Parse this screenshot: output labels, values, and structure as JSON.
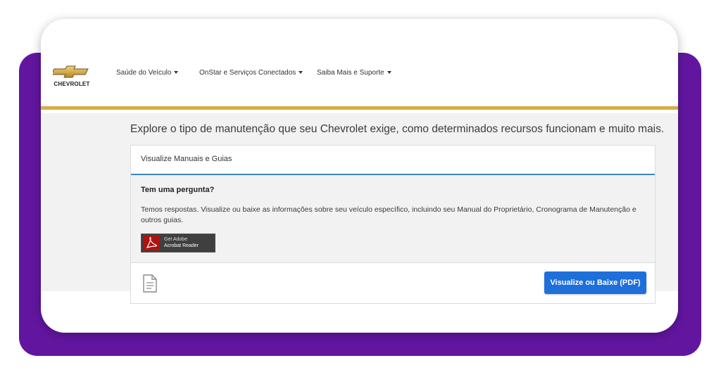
{
  "brand": {
    "logo_text": "CHEVROLET",
    "gold_color": "#d8ae43"
  },
  "nav": {
    "items": [
      {
        "label": "Saúde do Veículo"
      },
      {
        "label": "OnStar e Serviços Conectados"
      },
      {
        "label": "Saiba Mais e Suporte"
      }
    ]
  },
  "main": {
    "heading": "Explore o tipo de manutenção que seu Chevrolet exige, como determinados recursos funcionam e muito mais.",
    "panel": {
      "title": "Visualize Manuais e Guias",
      "question_title": "Tem uma pergunta?",
      "question_text": "Temos respostas. Visualize ou baixe as informações sobre seu veículo específico, incluindo seu Manual do Proprietário, Cronograma de Manutenção e outros guias.",
      "acrobat_line1": "Get Adobe",
      "acrobat_line2": "Acrobat Reader",
      "action_button": "Visualize ou Baixe (PDF)"
    }
  },
  "colors": {
    "frame_purple": "#6216a0",
    "accent_blue": "#1e6fd9",
    "panel_rule": "#3a87c8"
  },
  "icons": {
    "document": "document-icon",
    "acrobat": "acrobat-icon",
    "bowtie": "chevrolet-bowtie-icon",
    "caret": "caret-down-icon"
  }
}
